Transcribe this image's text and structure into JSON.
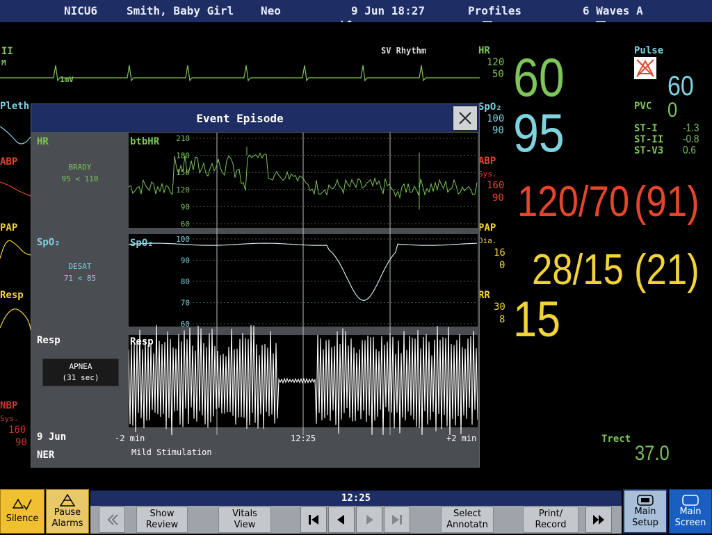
{
  "header": {
    "bed": "NICU6",
    "patient": "Smith, Baby Girl",
    "category": "Neo",
    "datetime": "9 Jun 18:27",
    "profiles": "Profiles",
    "waves": "6 Waves A"
  },
  "waves": {
    "ecg_lead": "II",
    "ecg_unit": "M",
    "ecg_cal": "1mV",
    "rhythm": "SV Rhythm",
    "pleth": "Pleth",
    "abp": "ABP",
    "pap": "PAP",
    "resp": "Resp",
    "nbp": "NBP",
    "nbp_sub": "Sys.",
    "nbp_hi": "160",
    "nbp_lo": "90"
  },
  "params": {
    "hr_label": "HR",
    "hr_hi": "120",
    "hr_lo": "50",
    "hr_value": "60",
    "spo2_label": "SpO₂",
    "spo2_hi": "100",
    "spo2_lo": "90",
    "spo2_value": "95",
    "abp_label": "ABP",
    "abp_sub": "Sys.",
    "abp_hi": "160",
    "abp_lo": "90",
    "abp_value": "120/70",
    "abp_mean": "(91)",
    "pap_label": "PAP",
    "pap_sub": "Dia.",
    "pap_hi": "16",
    "pap_lo": "0",
    "pap_value": "28/15",
    "pap_mean": "(21)",
    "rr_label": "RR",
    "rr_hi": "30",
    "rr_lo": "8",
    "rr_value": "15",
    "pulse_label": "Pulse",
    "pulse_value": "60",
    "pvc_label": "PVC",
    "pvc_value": "0",
    "st1_label": "ST-I",
    "st1_value": "-1.3",
    "st2_label": "ST-II",
    "st2_value": "-0.8",
    "st3_label": "ST-V3",
    "st3_value": "0.6",
    "trect_label": "Trect",
    "trect_value": "37.0"
  },
  "dialog": {
    "title": "Event Episode",
    "hr_label": "HR",
    "hr_event": "BRADY",
    "hr_detail": "95 < 110",
    "spo2_label": "SpO₂",
    "spo2_event": "DESAT",
    "spo2_detail": "71 < 85",
    "resp_label": "Resp",
    "resp_event": "APNEA",
    "resp_detail": "(31 sec)",
    "date": "9 Jun",
    "ner": "NER",
    "time_left": "-2 min",
    "time_center": "12:25",
    "time_right": "+2 min",
    "annotation": "Mild Stimulation",
    "chart1_label": "btbHR",
    "chart1_ticks": [
      "210",
      "180",
      "150",
      "120",
      "90",
      "60"
    ],
    "chart2_label": "SpO₂",
    "chart2_ticks": [
      "100",
      "90",
      "80",
      "70",
      "60"
    ],
    "chart3_label": "Resp"
  },
  "footer": {
    "silence": "Silence",
    "pause_1": "Pause",
    "pause_2": "Alarms",
    "show_1": "Show",
    "show_2": "Review",
    "vitals_1": "Vitals",
    "vitals_2": "View",
    "time": "12:25",
    "select_1": "Select",
    "select_2": "Annotatn",
    "print_1": "Print/",
    "print_2": "Record",
    "main_setup_1": "Main",
    "main_setup_2": "Setup",
    "main_screen_1": "Main",
    "main_screen_2": "Screen"
  },
  "colors": {
    "hr": "#7dc55a",
    "spo2": "#7fd3e0",
    "abp": "#e5452a",
    "pap": "#f2d33a",
    "nbp": "#c1392b",
    "topbar": "#1e2d63"
  }
}
